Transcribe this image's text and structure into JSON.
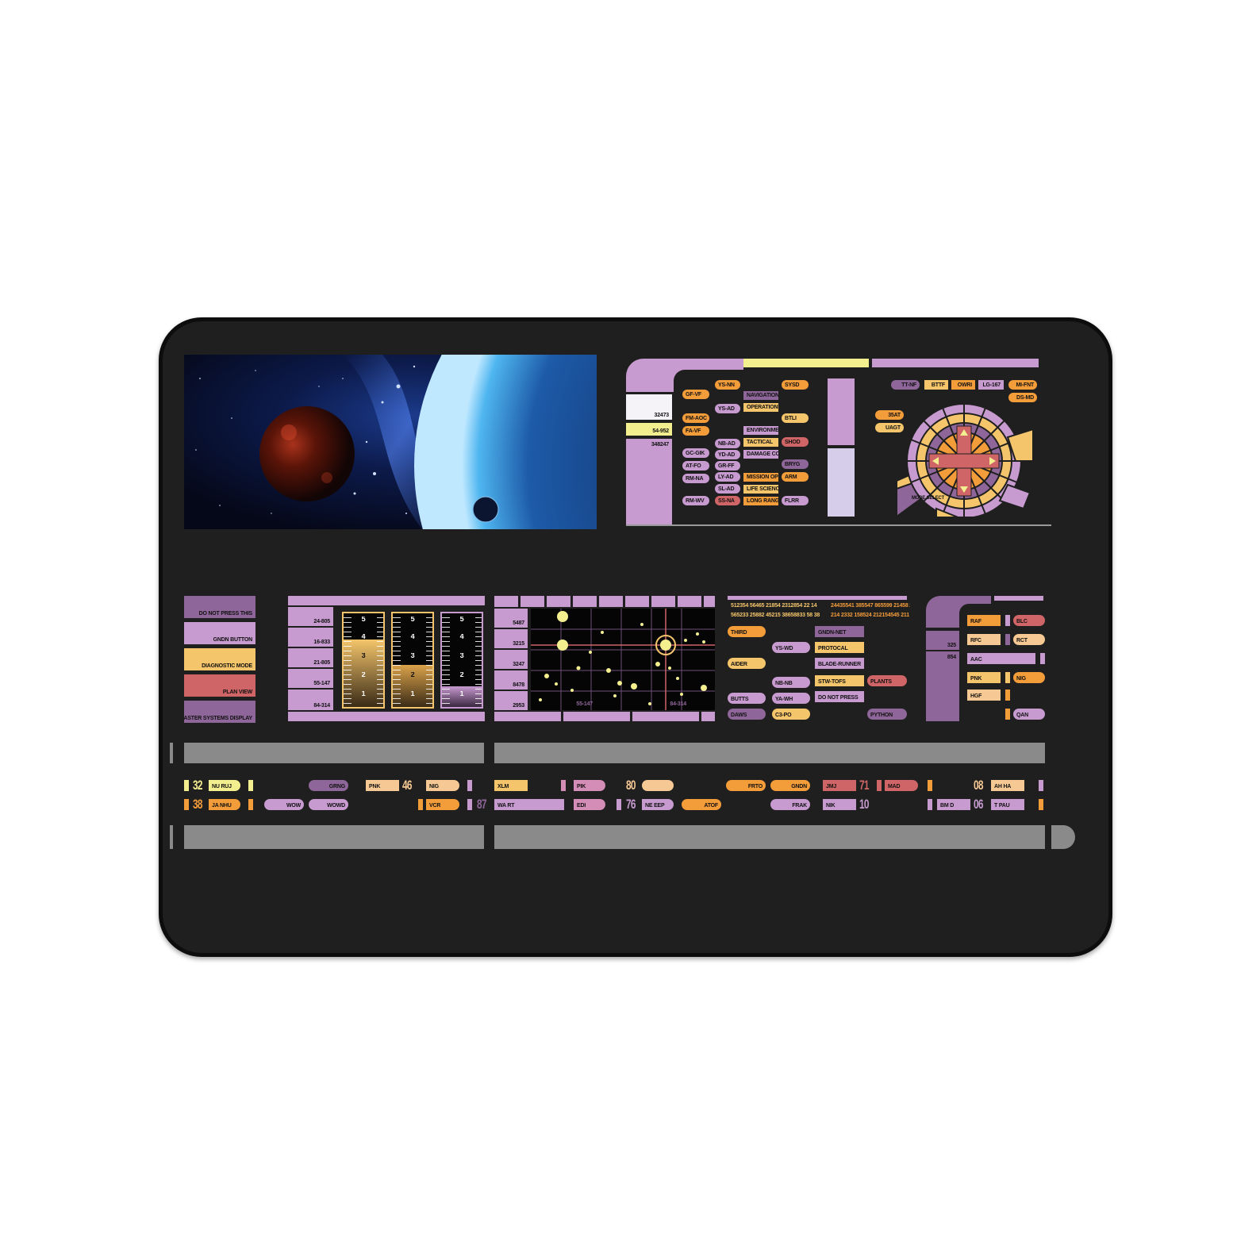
{
  "colors": {
    "lilac": "#c79ad0",
    "violet": "#8e6699",
    "orange": "#f39c3a",
    "peach": "#f6c994",
    "gold": "#f4c56b",
    "salmon": "#cf6566",
    "pale_yellow": "#f3ef8f",
    "lavender": "#d6cdea",
    "pink": "#d48db6",
    "grey_bar": "#8a8a8a",
    "panel": "#1f1f1f"
  },
  "top_right_panel": {
    "readouts": [
      "32473",
      "54-952",
      "348247"
    ],
    "menu_left": [
      "GF-VF",
      "FM-AOC",
      "FA-VF",
      "GC-GIK",
      "AT-FO",
      "RM-NA",
      "RM-WV"
    ],
    "menu_small": [
      "YS-NN",
      "YS-AD",
      "NB-AD",
      "YD-AD",
      "GR-FF",
      "SL-AD",
      "SS-NA",
      "LY-AD"
    ],
    "menu_functions": [
      "NAVIGATION",
      "OPERATIONS",
      "ENVIRONMENTAL",
      "TACTICAL",
      "DAMAGE CONTROL",
      "MISSION OPS",
      "LIFE SCIENCES",
      "LONG RANGE SNS"
    ],
    "menu_right": [
      "SYSD",
      "BTLI",
      "SHOD",
      "BRYG",
      "ARM",
      "FLRR"
    ],
    "ring_top": [
      "TT-NF",
      "BTTF",
      "OWRI",
      "LG-167",
      "MI-FNT",
      "DS-MD"
    ],
    "ring_left": [
      "35AT",
      "UAGT"
    ],
    "ring_numbers": [
      "95",
      "98",
      "75",
      "17",
      "8",
      "12",
      "87",
      "35",
      "4",
      "71",
      "78",
      "52",
      "12",
      "11",
      "93",
      "21",
      "30",
      "55",
      "24",
      "47",
      "43"
    ],
    "mode_select": "MODE SELECT"
  },
  "left_buttons": [
    "DO NOT PRESS THIS",
    "GNDN BUTTON",
    "DIAGNOSTIC MODE",
    "PLAN VIEW",
    "MASTER SYSTEMS DISPLAY"
  ],
  "gauge_panel": {
    "labels": [
      "24-805",
      "16-833",
      "21-805",
      "55-147",
      "84-314"
    ],
    "ticks": [
      "5",
      "4",
      "3",
      "2",
      "1"
    ],
    "levels": [
      0.72,
      0.45,
      0.22
    ]
  },
  "grid_panel": {
    "labels": [
      "5487",
      "3215",
      "3247",
      "8478",
      "2953"
    ],
    "bottom_labels": [
      "55-147",
      "84-314"
    ]
  },
  "text_panel": {
    "numbers_left": [
      "512354 56465 21854 2312854 22 14",
      "565233 25882 45215 38658833 58 38"
    ],
    "numbers_right": [
      "24435541 385547 865599 21458 21 32",
      "214 2332 158524 212154545 211 3325"
    ],
    "col1": [
      "THIRD",
      "AIDER",
      "BUTTS",
      "DAWS"
    ],
    "col2": [
      "YS-WD",
      "NB-NB",
      "YA-WH",
      "C3-PO"
    ],
    "col3": [
      "GNDN-NET",
      "PROTOCAL",
      "BLADE-RUNNER",
      "STW-TOFS",
      "DO NOT PRESS"
    ],
    "col4": [
      "PLANTS",
      "PYTHON"
    ]
  },
  "right_panel": {
    "numbers": [
      "325",
      "854"
    ],
    "col1": [
      "RAF",
      "RFC",
      "AAC",
      "PNK",
      "HGF"
    ],
    "col2": [
      "BLC",
      "RCT",
      "NIG",
      "QAN"
    ]
  },
  "bottom_strip": {
    "big_numbers": [
      "32",
      "38",
      "46",
      "87",
      "80",
      "76",
      "71",
      "10",
      "08",
      "06"
    ],
    "labels": [
      "NU RUJ",
      "JA NHU",
      "GRNG",
      "WOW",
      "WOWD",
      "PNK",
      "NIG",
      "VCR",
      "XLM",
      "WA RT",
      "PIK",
      "EDI",
      "NE EEP",
      "ATOF",
      "FRTO",
      "GNDN",
      "FRAK",
      "JMJ",
      "NIK",
      "MAD",
      "BM D",
      "AH HA",
      "T PAU"
    ]
  }
}
